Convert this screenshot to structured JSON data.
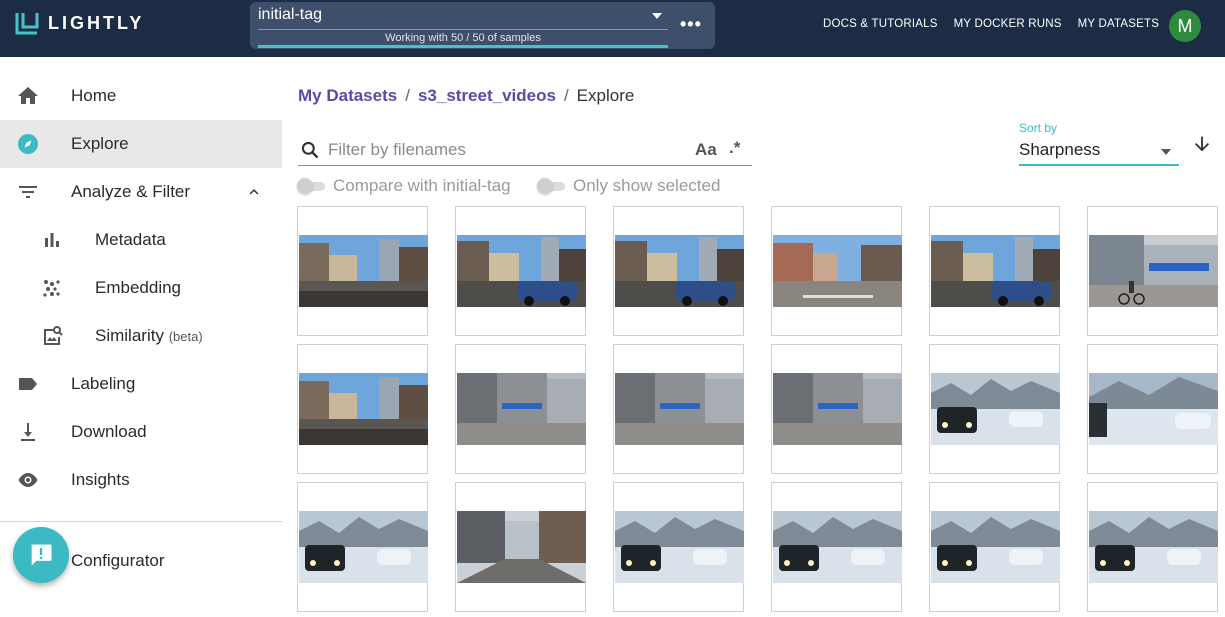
{
  "app": {
    "logo_text": "LIGHTLY",
    "brand_color": "#1c2c45",
    "accent_color": "#3bbac3"
  },
  "tag_selector": {
    "name": "initial-tag",
    "status": "Working with 50 / 50 of samples",
    "progress": 1.0,
    "more_icon": "more-horiz-icon"
  },
  "nav": {
    "docs": "DOCS & TUTORIALS",
    "docker_runs": "MY DOCKER RUNS",
    "datasets": "MY DATASETS",
    "avatar_initial": "M"
  },
  "sidebar": {
    "items": [
      {
        "label": "Home",
        "icon": "home-icon"
      },
      {
        "label": "Explore",
        "icon": "compass-icon",
        "active": true
      },
      {
        "label": "Analyze & Filter",
        "icon": "filter-icon",
        "expanded": true
      },
      {
        "label": "Metadata",
        "icon": "bar-chart-icon"
      },
      {
        "label": "Embedding",
        "icon": "scatter-dots-icon"
      },
      {
        "label": "Similarity",
        "beta": "(beta)",
        "icon": "image-search-icon"
      },
      {
        "label": "Labeling",
        "icon": "label-tag-icon"
      },
      {
        "label": "Download",
        "icon": "download-icon"
      },
      {
        "label": "Insights",
        "icon": "eye-icon"
      },
      {
        "label": "Configurator",
        "icon": "feedback-icon"
      }
    ]
  },
  "breadcrumb": {
    "root": "My Datasets",
    "dataset": "s3_street_videos",
    "current": "Explore",
    "separator": "/"
  },
  "search": {
    "placeholder": "Filter by filenames",
    "value": "",
    "case_option": "Aa",
    "regex_option": ".*"
  },
  "toggles": {
    "compare_label": "Compare with initial-tag",
    "only_selected_label": "Only show selected",
    "compare_on": false,
    "only_selected_on": false
  },
  "sort": {
    "label": "Sort by",
    "value": "Sharpness",
    "direction": "descending"
  },
  "thumbnails": [
    {
      "scene": "street-sunny"
    },
    {
      "scene": "street-sunny-car"
    },
    {
      "scene": "street-sunny-car"
    },
    {
      "scene": "street-sunny-crossing"
    },
    {
      "scene": "street-sunny-car"
    },
    {
      "scene": "street-cyclist"
    },
    {
      "scene": "street-sunny"
    },
    {
      "scene": "street-grey-building"
    },
    {
      "scene": "street-grey-building"
    },
    {
      "scene": "street-grey-building"
    },
    {
      "scene": "snow-suv"
    },
    {
      "scene": "snow-street"
    },
    {
      "scene": "snow-suv"
    },
    {
      "scene": "street-empty-road"
    },
    {
      "scene": "snow-suv"
    },
    {
      "scene": "snow-suv"
    },
    {
      "scene": "snow-suv"
    },
    {
      "scene": "snow-suv"
    }
  ]
}
